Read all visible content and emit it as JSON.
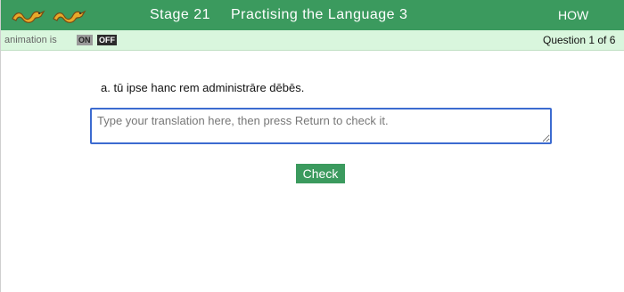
{
  "header": {
    "stage": "Stage 21",
    "title": "Practising the Language 3",
    "howto_label": "HOW",
    "logo_icon": "cambridge-latin-snake-logo",
    "background_color": "#3b9a5e",
    "text_color": "#ffffff"
  },
  "subbar": {
    "animation_label": "animation is",
    "toggle_on": "ON",
    "toggle_off": "OFF",
    "question_count": "Question 1 of 6",
    "background_color": "#d9f6dd"
  },
  "exercise": {
    "prompt": "a. tū ipse hanc rem administrāre dēbēs.",
    "answer_value": "",
    "answer_placeholder": "Type your translation here, then press Return to check it.",
    "check_label": "Check",
    "focus_color": "#3c6bd0"
  }
}
